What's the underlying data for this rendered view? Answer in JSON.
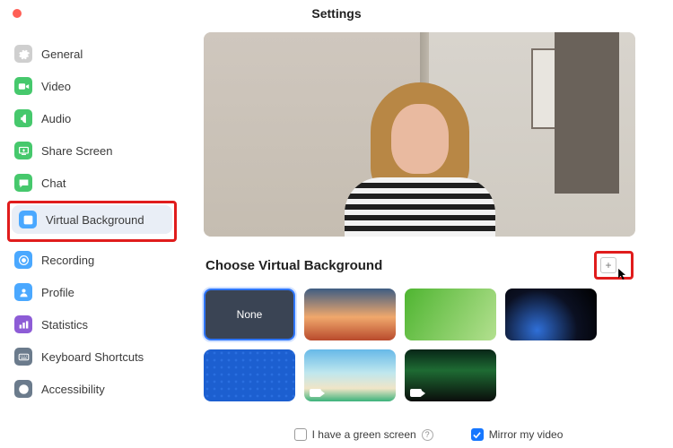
{
  "title": "Settings",
  "sidebar": {
    "items": [
      {
        "label": "General",
        "color": "gray",
        "icon": "gear"
      },
      {
        "label": "Video",
        "color": "green",
        "icon": "video"
      },
      {
        "label": "Audio",
        "color": "green",
        "icon": "audio"
      },
      {
        "label": "Share Screen",
        "color": "green",
        "icon": "share"
      },
      {
        "label": "Chat",
        "color": "green",
        "icon": "chat"
      },
      {
        "label": "Virtual Background",
        "color": "blue",
        "icon": "user",
        "selected": true,
        "highlight": true
      },
      {
        "label": "Recording",
        "color": "blue",
        "icon": "record"
      },
      {
        "label": "Profile",
        "color": "blue",
        "icon": "profile"
      },
      {
        "label": "Statistics",
        "color": "purple",
        "icon": "stats"
      },
      {
        "label": "Keyboard Shortcuts",
        "color": "slate",
        "icon": "keyboard"
      },
      {
        "label": "Accessibility",
        "color": "slate",
        "icon": "accessibility"
      }
    ]
  },
  "main": {
    "section_title": "Choose Virtual Background",
    "none_label": "None",
    "greenscreen_label": "I have a green screen",
    "mirror_label": "Mirror my video",
    "greenscreen_checked": false,
    "mirror_checked": true,
    "add_button_highlighted": true
  }
}
